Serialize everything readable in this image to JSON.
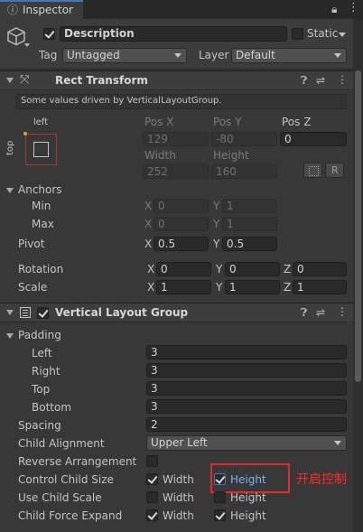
{
  "tab": {
    "title": "Inspector"
  },
  "object": {
    "active": true,
    "name": "Description",
    "static_label": "Static",
    "tag_label": "Tag",
    "tag_value": "Untagged",
    "layer_label": "Layer",
    "layer_value": "Default"
  },
  "rect_transform": {
    "title": "Rect Transform",
    "info": "Some values driven by VerticalLayoutGroup.",
    "anchor_h": "left",
    "anchor_v": "top",
    "pos_x_label": "Pos X",
    "pos_x": "129",
    "pos_y_label": "Pos Y",
    "pos_y": "-80",
    "pos_z_label": "Pos Z",
    "pos_z": "0",
    "width_label": "Width",
    "width": "252",
    "height_label": "Height",
    "height": "160",
    "r_button": "R",
    "anchors_label": "Anchors",
    "min_label": "Min",
    "min_x": "0",
    "min_y": "1",
    "max_label": "Max",
    "max_x": "0",
    "max_y": "1",
    "pivot_label": "Pivot",
    "pivot_x": "0.5",
    "pivot_y": "0.5",
    "rotation_label": "Rotation",
    "rot_x": "0",
    "rot_y": "0",
    "rot_z": "0",
    "scale_label": "Scale",
    "scale_x": "1",
    "scale_y": "1",
    "scale_z": "1",
    "x": "X",
    "y": "Y",
    "z": "Z"
  },
  "layout_group": {
    "title": "Vertical Layout Group",
    "enabled": true,
    "padding_label": "Padding",
    "left_label": "Left",
    "left": "3",
    "right_label": "Right",
    "right": "3",
    "top_label": "Top",
    "top": "3",
    "bottom_label": "Bottom",
    "bottom": "3",
    "spacing_label": "Spacing",
    "spacing": "2",
    "child_alignment_label": "Child Alignment",
    "child_alignment": "Upper Left",
    "reverse_label": "Reverse Arrangement",
    "reverse": false,
    "control_size_label": "Control Child Size",
    "control_width": true,
    "control_height": true,
    "use_scale_label": "Use Child Scale",
    "use_scale_width": false,
    "use_scale_height": false,
    "force_expand_label": "Child Force Expand",
    "force_width": true,
    "force_height": true,
    "width_label": "Width",
    "height_label": "Height"
  },
  "annotation": {
    "text": "开启控制",
    "color": "#ff2a2a"
  },
  "colors": {
    "accent": "#3a79bb",
    "highlight_text": "#7fb0f0",
    "annotation_border": "#e22a2a"
  }
}
